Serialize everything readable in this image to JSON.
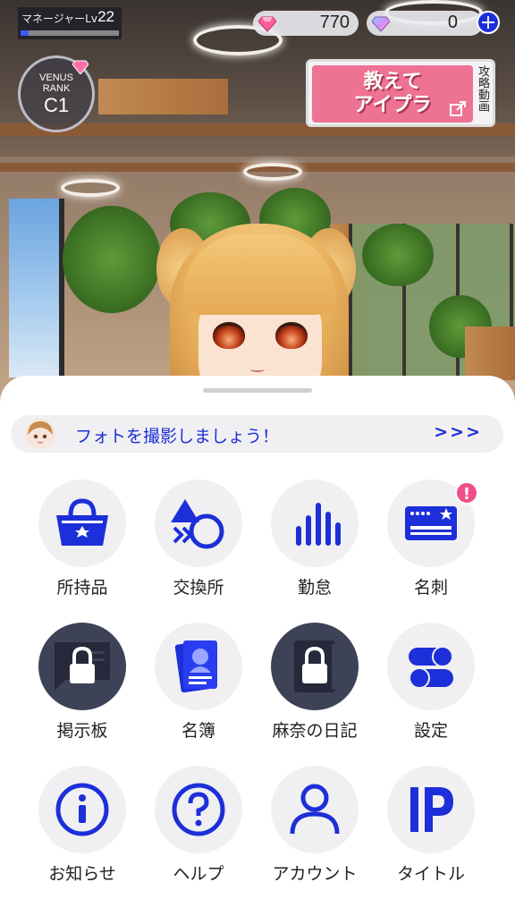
{
  "hud": {
    "manager_label": "マネージャーLv",
    "manager_level": "22",
    "manager_progress": 0.08,
    "rank_title_line1": "VENUS",
    "rank_title_line2": "RANK",
    "rank_value": "C1",
    "paid_gems": "770",
    "free_gems": "0",
    "plus_label": "+",
    "guide_title_line1": "教えて",
    "guide_title_line2": "アイプラ",
    "guide_side_text": "攻略動画"
  },
  "banner": {
    "text": "フォトを撮影しましょう！",
    "arrow": ">>>"
  },
  "menu": [
    {
      "label": "所持品",
      "icon": "bag-icon",
      "locked": false
    },
    {
      "label": "交換所",
      "icon": "exchange-icon",
      "locked": false
    },
    {
      "label": "勤怠",
      "icon": "bar-chart-icon",
      "locked": false
    },
    {
      "label": "名刺",
      "icon": "business-card-icon",
      "locked": false,
      "badge": "!"
    },
    {
      "label": "掲示板",
      "icon": "bulletin-board-icon",
      "locked": true
    },
    {
      "label": "名簿",
      "icon": "roster-icon",
      "locked": false
    },
    {
      "label": "麻奈の日記",
      "icon": "diary-icon",
      "locked": true
    },
    {
      "label": "設定",
      "icon": "settings-toggle-icon",
      "locked": false
    },
    {
      "label": "お知らせ",
      "icon": "info-icon",
      "locked": false
    },
    {
      "label": "ヘルプ",
      "icon": "help-icon",
      "locked": false
    },
    {
      "label": "アカウント",
      "icon": "account-icon",
      "locked": false
    },
    {
      "label": "タイトル",
      "icon": "title-logo-icon",
      "locked": false
    }
  ],
  "colors": {
    "accent": "#1d2fd8",
    "locked_tile": "#3d4256",
    "tile_bg": "#f0f0f2",
    "badge": "#ee4f8a",
    "guide_pink": "#ee7393"
  }
}
